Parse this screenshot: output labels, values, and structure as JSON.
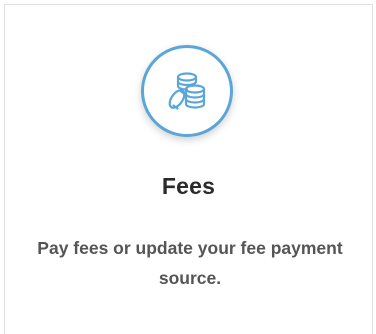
{
  "card": {
    "icon": "coins-icon",
    "title": "Fees",
    "description": "Pay fees or update your fee payment source."
  },
  "colors": {
    "accent": "#5aa6d8",
    "title_text": "#2b2b2b",
    "body_text": "#555555",
    "border": "#e1e1e1"
  }
}
